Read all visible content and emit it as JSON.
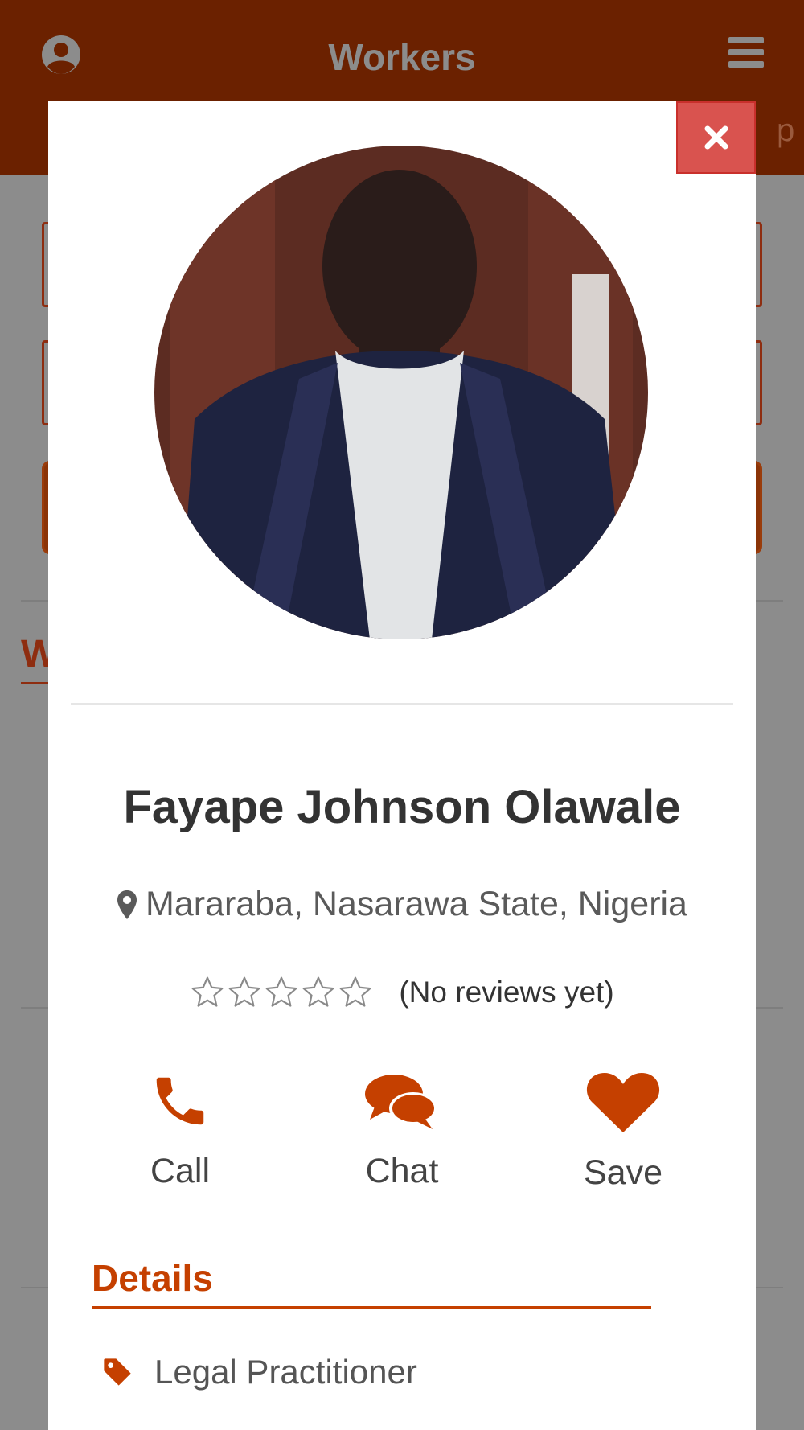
{
  "header": {
    "title": "Workers",
    "peek_text": "p"
  },
  "background": {
    "tab_label": "W"
  },
  "colors": {
    "header_bg": "#6b2100",
    "accent": "#c54000",
    "close_button": "#d9534f",
    "overlay_gray": "#8c8c8c"
  },
  "profile": {
    "name": "Fayape Johnson Olawale",
    "location": "Mararaba, Nasarawa State, Nigeria",
    "rating": 0,
    "max_rating": 5,
    "reviews_text": "(No reviews yet)"
  },
  "actions": [
    {
      "label": "Call",
      "icon": "phone-icon"
    },
    {
      "label": "Chat",
      "icon": "chat-icon"
    },
    {
      "label": "Save",
      "icon": "heart-icon"
    }
  ],
  "details": {
    "title": "Details",
    "items": [
      {
        "icon": "tag-icon",
        "text": "Legal Practitioner"
      }
    ]
  },
  "icons": {
    "close": "close-icon",
    "user": "user-circle-icon",
    "menu": "hamburger-menu-icon",
    "location": "map-marker-icon",
    "star": "star-outline-icon"
  }
}
